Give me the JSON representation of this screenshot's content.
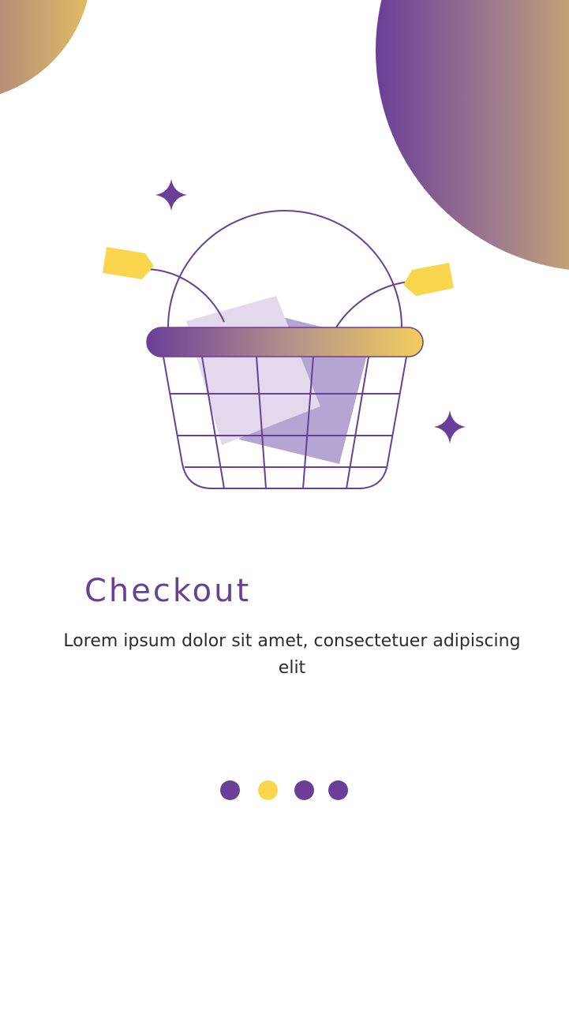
{
  "onboarding": {
    "title": "Checkout",
    "description": "Lorem ipsum dolor sit amet, consectetuer adipiscing elit",
    "illustration_icon": "shopping-basket-icon",
    "pagination": {
      "total_pages": 4,
      "active_page": 2
    }
  },
  "colors": {
    "primary": "#6a3f97",
    "accent": "#fad54e",
    "text": "#2c2c2c",
    "background": "#ffffff",
    "dot_inactive": "#6a3f97",
    "dot_active": "#fad54e"
  }
}
